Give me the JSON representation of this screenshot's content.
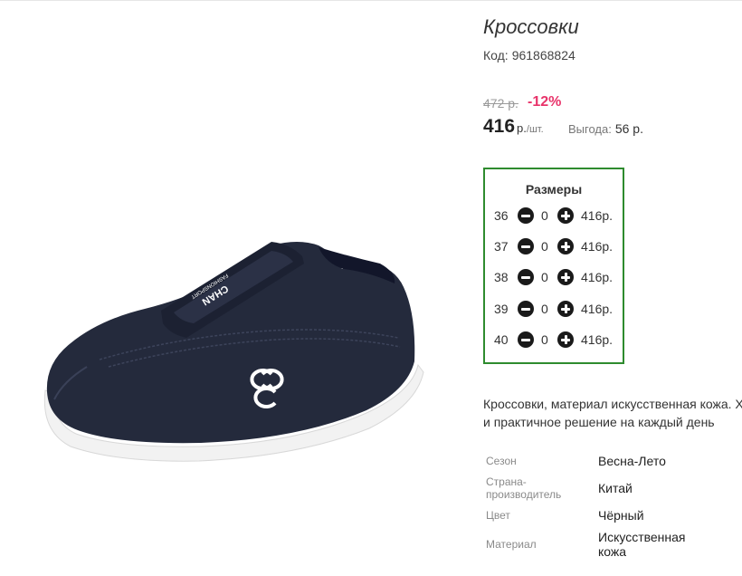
{
  "product": {
    "title": "Кроссовки",
    "code_label": "Код:",
    "code_value": "961868824",
    "image_alt_icon": "sneaker-photo",
    "brand_print_line1": "CHAN",
    "brand_print_line2": "FASHIONSPORT"
  },
  "pricing": {
    "old_price": "472 р.",
    "discount": "-12%",
    "price": "416",
    "currency": "р.",
    "per_unit": "/шт.",
    "benefit_label": "Выгода:",
    "benefit_value": "56 р."
  },
  "sizes": {
    "title": "Размеры",
    "rows": [
      {
        "size": "36",
        "qty": "0",
        "price": "416р."
      },
      {
        "size": "37",
        "qty": "0",
        "price": "416р."
      },
      {
        "size": "38",
        "qty": "0",
        "price": "416р."
      },
      {
        "size": "39",
        "qty": "0",
        "price": "416р."
      },
      {
        "size": "40",
        "qty": "0",
        "price": "416р."
      }
    ],
    "minus_icon": "minus-circle-icon",
    "plus_icon": "plus-circle-icon"
  },
  "description": {
    "line1": "Кроссовки, материал искусственная кожа. Х",
    "line2": "и практичное решение на каждый день"
  },
  "attributes": [
    {
      "label": "Сезон",
      "value": "Весна-Лето"
    },
    {
      "label": "Страна-производитель",
      "label_line1": "Страна-",
      "label_line2": "производитель",
      "value": "Китай"
    },
    {
      "label": "Цвет",
      "value": "Чёрный"
    },
    {
      "label": "Материал",
      "value": "Искусственная кожа",
      "value_line1": "Искусственная",
      "value_line2": "кожа"
    }
  ],
  "colors": {
    "sizes_border": "#2e8b2e",
    "discount": "#e8336a",
    "old_price": "#9a9a9a",
    "shoe_body": "#242a3c",
    "shoe_sole": "#f2f2f2"
  }
}
